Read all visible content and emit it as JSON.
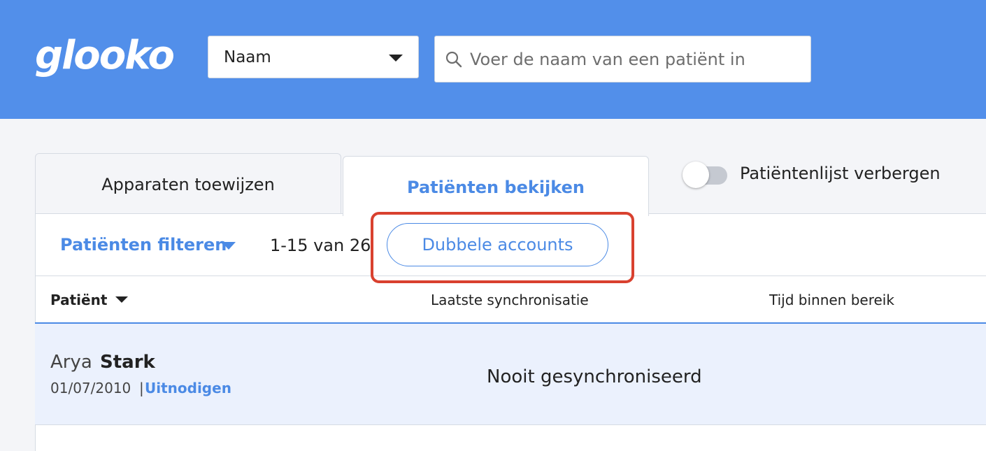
{
  "header": {
    "logo": "glooko",
    "select_value": "Naam",
    "search_placeholder": "Voer de naam van een patiënt in"
  },
  "tabs": [
    {
      "label": "Apparaten toewijzen",
      "active": false
    },
    {
      "label": "Patiënten bekijken",
      "active": true
    }
  ],
  "toggle": {
    "label": "Patiëntenlijst verbergen",
    "on": false
  },
  "toolbar": {
    "filter_label": "Patiënten filteren",
    "count": "1-15 van 26",
    "duplicate_button": "Dubbele accounts"
  },
  "table": {
    "columns": [
      "Patiënt",
      "Laatste synchronisatie",
      "Tijd binnen bereik"
    ],
    "rows": [
      {
        "first_name": "Arya",
        "last_name": "Stark",
        "dob": "01/07/2010",
        "separator": "|",
        "invite": "Uitnodigen",
        "last_sync": "Nooit gesynchroniseerd"
      }
    ]
  },
  "colors": {
    "brand": "#528fea",
    "accent": "#4b8ae5",
    "highlight": "#d9412f"
  }
}
